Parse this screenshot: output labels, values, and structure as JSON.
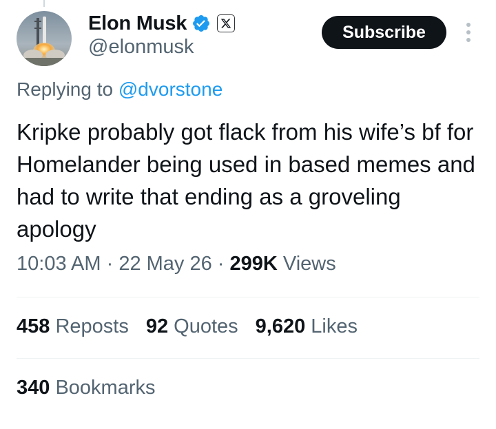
{
  "author": {
    "display_name": "Elon Musk",
    "handle": "@elonmusk",
    "avatar_icon": "rocket-launch-avatar",
    "verified_icon": "verified-badge-icon",
    "affiliate_icon": "x-logo-icon"
  },
  "header": {
    "subscribe_label": "Subscribe",
    "more_icon": "more-vertical-icon"
  },
  "reply": {
    "prefix": "Replying to ",
    "mention": "@dvorstone"
  },
  "tweet": {
    "text": "Kripke probably got flack from his wife’s bf for Homelander being used in based memes and had to write that ending as a groveling apology"
  },
  "meta": {
    "time": "10:03 AM",
    "sep1": " · ",
    "date": "22 May 26",
    "sep2": " · ",
    "views_count": "299K",
    "views_label": " Views"
  },
  "stats": {
    "reposts_count": "458",
    "reposts_label": " Reposts",
    "quotes_count": "92",
    "quotes_label": " Quotes",
    "likes_count": "9,620",
    "likes_label": " Likes",
    "bookmarks_count": "340",
    "bookmarks_label": " Bookmarks"
  },
  "colors": {
    "text_primary": "#0f1419",
    "text_secondary": "#536471",
    "accent_blue": "#1d9bf0",
    "divider": "#eff3f4",
    "button_bg": "#0f1419"
  }
}
